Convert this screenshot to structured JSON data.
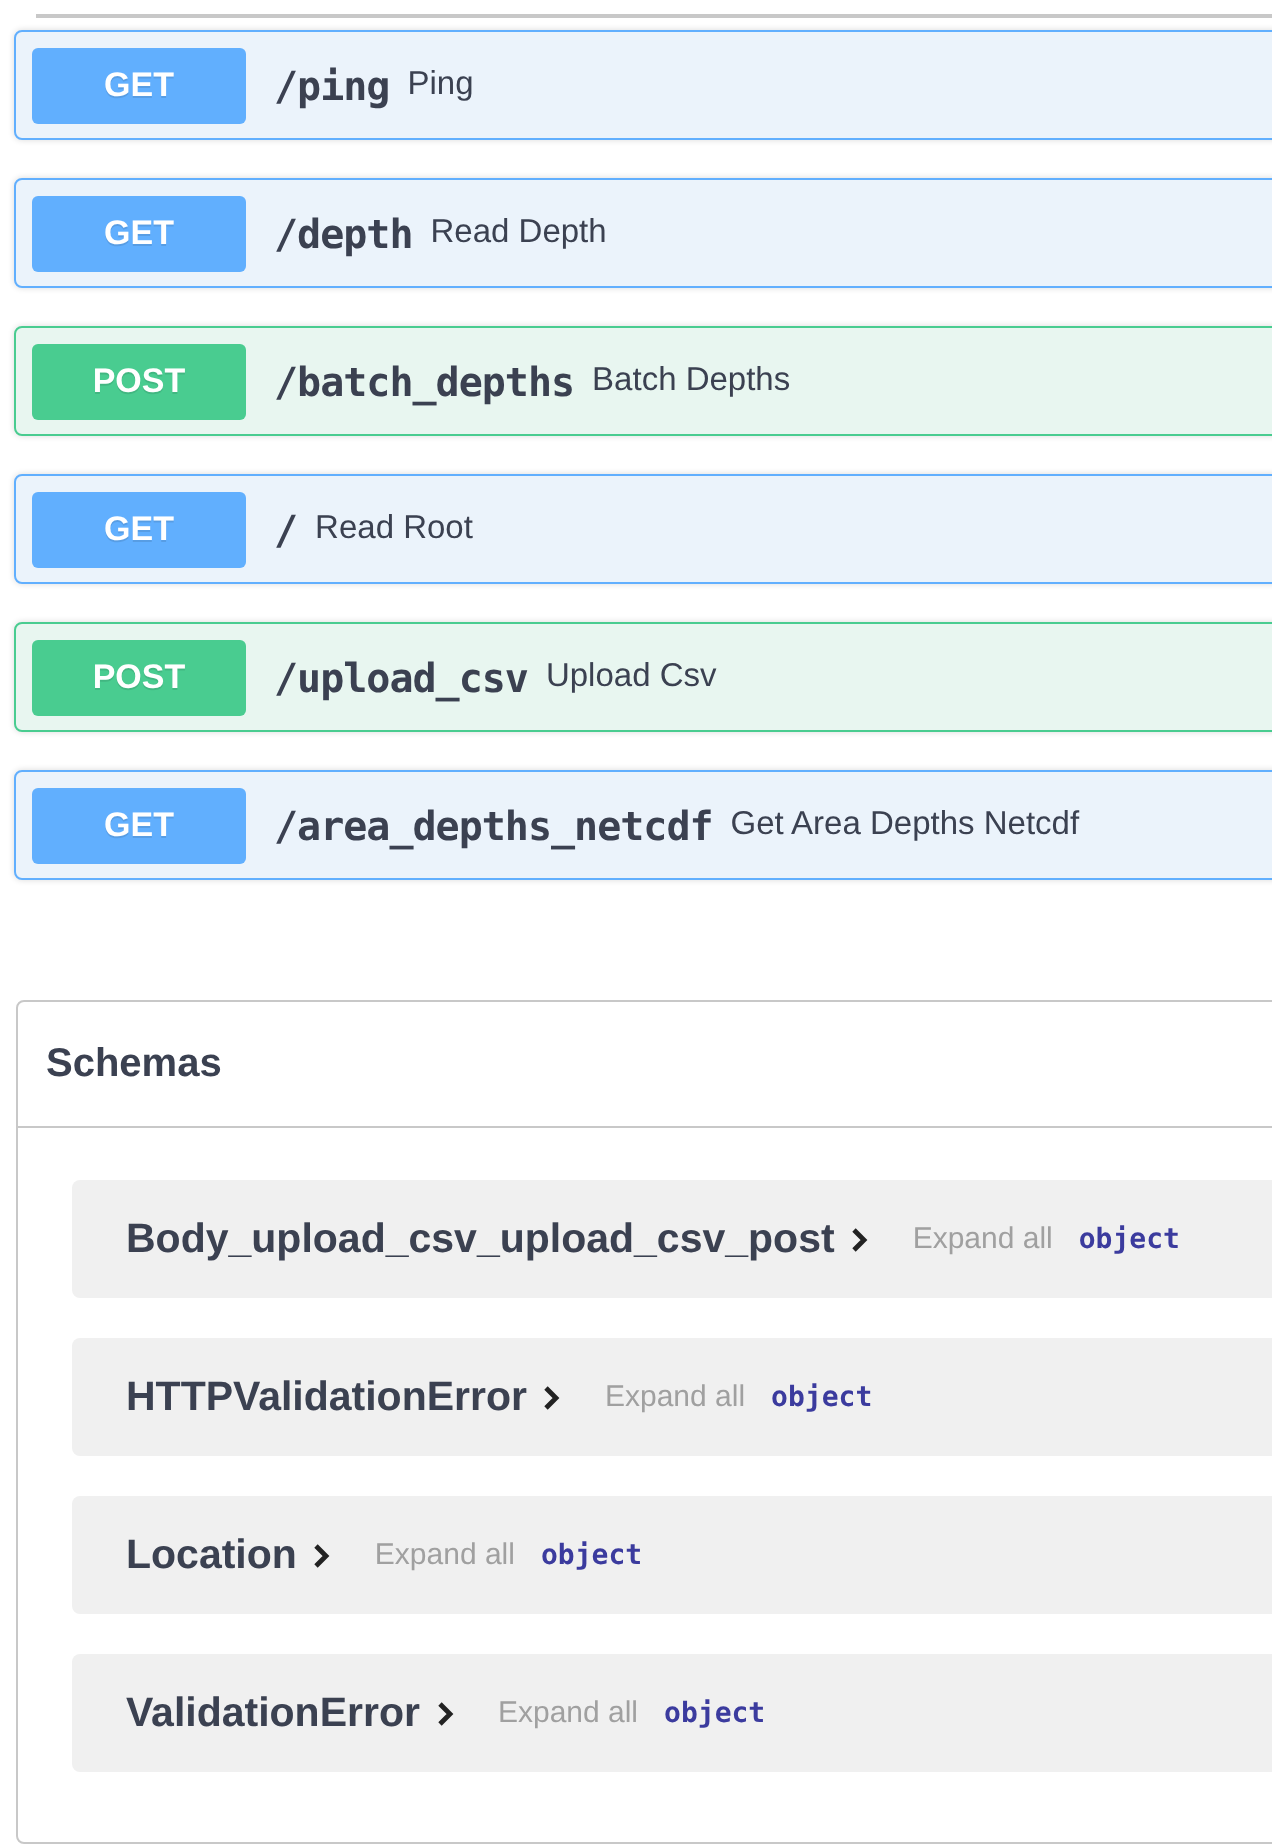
{
  "operations": [
    {
      "method": "GET",
      "kind": "get",
      "path": "/ping",
      "summary": "Ping"
    },
    {
      "method": "GET",
      "kind": "get",
      "path": "/depth",
      "summary": "Read Depth"
    },
    {
      "method": "POST",
      "kind": "post",
      "path": "/batch_depths",
      "summary": "Batch Depths"
    },
    {
      "method": "GET",
      "kind": "get",
      "path": "/",
      "summary": "Read Root"
    },
    {
      "method": "POST",
      "kind": "post",
      "path": "/upload_csv",
      "summary": "Upload Csv"
    },
    {
      "method": "GET",
      "kind": "get",
      "path": "/area_depths_netcdf",
      "summary": "Get Area Depths Netcdf"
    }
  ],
  "schemas": {
    "title": "Schemas",
    "items": [
      {
        "name": "Body_upload_csv_upload_csv_post",
        "expand_label": "Expand all",
        "type": "object"
      },
      {
        "name": "HTTPValidationError",
        "expand_label": "Expand all",
        "type": "object"
      },
      {
        "name": "Location",
        "expand_label": "Expand all",
        "type": "object"
      },
      {
        "name": "ValidationError",
        "expand_label": "Expand all",
        "type": "object"
      }
    ]
  }
}
